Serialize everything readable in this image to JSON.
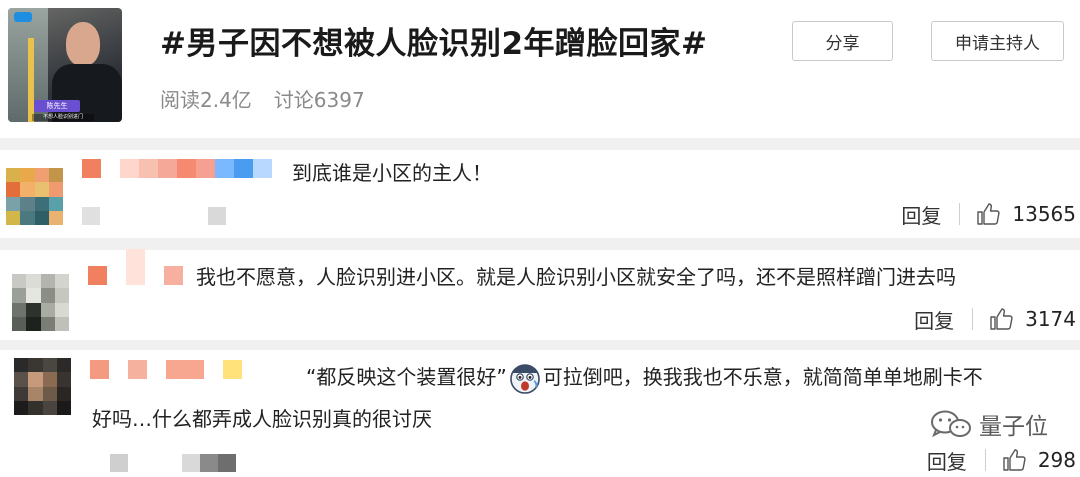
{
  "topic": {
    "title": "#男子因不想被人脸识别2年蹭脸回家#",
    "reads": "阅读2.4亿",
    "discussions": "讨论6397",
    "thumbnail_name_tag": "陈先生",
    "thumbnail_caption": "不想人脸识别进门",
    "share_label": "分享",
    "apply_host_label": "申请主持人"
  },
  "comments": [
    {
      "text": "到底谁是小区的主人！",
      "reply_label": "回复",
      "likes": "13565",
      "avatar_colors": [
        "#d8b04c",
        "#e9a94a",
        "#f0a070",
        "#c2954a",
        "#e36e3c",
        "#f3b06a",
        "#e8c070",
        "#f09a70",
        "#7aa0a8",
        "#5e8088",
        "#3e6e78",
        "#5aa0a8",
        "#d2b64a",
        "#4a7a80",
        "#2e5e66",
        "#e9b270"
      ],
      "nick_colors": [
        "#f08060",
        "#ffffff",
        "#ffd6cc",
        "#f7c0b0",
        "#f6a898",
        "#f58a70",
        "#f5a090",
        "#7cb8ff",
        "#4a9cf0",
        "#b8d8ff"
      ],
      "meta_colors": [
        "#e0e0e0",
        "#ffffff",
        "#ffffff",
        "#ffffff",
        "#ffffff",
        "#ffffff",
        "#ffffff",
        "#d9d9d9"
      ]
    },
    {
      "text": "我也不愿意，人脸识别进小区。就是人脸识别小区就安全了吗，还不是照样蹭门进去吗",
      "reply_label": "回复",
      "likes": "3174",
      "avatar_colors": [
        "#c8c8c4",
        "#dcdcd6",
        "#b4b4ae",
        "#d4d4ce",
        "#9aa098",
        "#e6e6e0",
        "#8a8e86",
        "#c6c8c0",
        "#6e746c",
        "#2e322c",
        "#a8aca2",
        "#d8dad2",
        "#5a5e58",
        "#1e221e",
        "#7a7e76",
        "#bfc1b9"
      ],
      "nick_colors": [
        "#f08060",
        "#ffffff",
        "#ffe2da",
        "#ffffff",
        "#f7b0a0"
      ]
    },
    {
      "text_before": "“都反映这个装置很好”",
      "text_after": "可拉倒吧，换我我也不乐意，就简简单单地刷卡不",
      "text_line2": "好吗…什么都弄成人脸识别真的很讨厌",
      "reply_label": "回复",
      "likes": "298",
      "avatar_colors": [
        "#2a2a2a",
        "#3a3632",
        "#4a4640",
        "#2c2a28",
        "#5a524a",
        "#c69a7a",
        "#8a6a50",
        "#3a3430",
        "#3e3a36",
        "#a88468",
        "#6e5a48",
        "#2a2624",
        "#1e1c1a",
        "#34302c",
        "#4a4440",
        "#1c1a18"
      ],
      "nick_colors": [
        "#f49a80",
        "#ffffff",
        "#f6b09e",
        "#ffffff",
        "#f7a690",
        "#f7a690",
        "#ffffff",
        "#ffe27a"
      ],
      "meta_colors": [
        "#cfcfcf",
        "#ffffff",
        "#ffffff",
        "#ffffff",
        "#d9d9d9",
        "#8a8a8a",
        "#6e6e6e"
      ]
    }
  ],
  "watermark": {
    "text": "量子位",
    "icon": "wechat-icon"
  }
}
